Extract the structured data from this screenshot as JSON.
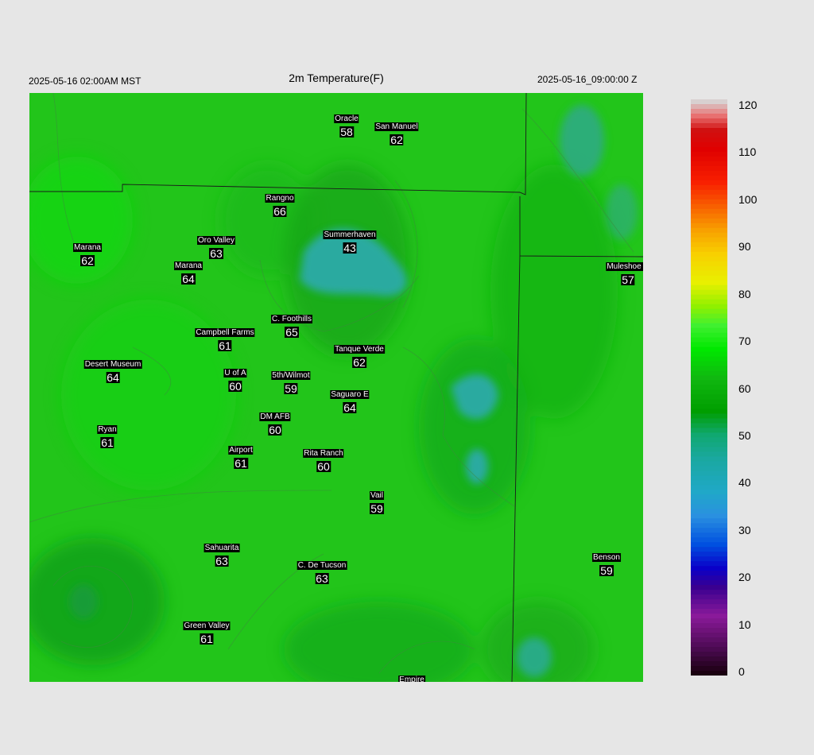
{
  "header": {
    "local_time": "2025-05-16 02:00AM MST",
    "title": "2m Temperature(F)",
    "utc_time": "2025-05-16_09:00:00 Z"
  },
  "map": {
    "base_color": "#22c51a",
    "cool_color": "#2aaaa0",
    "stations": [
      {
        "name": "Oracle",
        "value": "58"
      },
      {
        "name": "San Manuel",
        "value": "62"
      },
      {
        "name": "Rangno",
        "value": "66"
      },
      {
        "name": "Summerhaven",
        "value": "43"
      },
      {
        "name": "Marana",
        "value": "62"
      },
      {
        "name": "Oro Valley",
        "value": "63"
      },
      {
        "name": "Marana",
        "value": "64"
      },
      {
        "name": "Muleshoe R",
        "value": "57"
      },
      {
        "name": "C. Foothills",
        "value": "65"
      },
      {
        "name": "Campbell Farms",
        "value": "61"
      },
      {
        "name": "Tanque Verde",
        "value": "62"
      },
      {
        "name": "Desert Museum",
        "value": "64"
      },
      {
        "name": "U of A",
        "value": "60"
      },
      {
        "name": "5th/Wilmot",
        "value": "59"
      },
      {
        "name": "Saguaro E",
        "value": "64"
      },
      {
        "name": "DM AFB",
        "value": "60"
      },
      {
        "name": "Ryan",
        "value": "61"
      },
      {
        "name": "Airport",
        "value": "61"
      },
      {
        "name": "Rita Ranch",
        "value": "60"
      },
      {
        "name": "Vail",
        "value": "59"
      },
      {
        "name": "Sahuarita",
        "value": "63"
      },
      {
        "name": "C. De Tucson",
        "value": "63"
      },
      {
        "name": "Benson",
        "value": "59"
      },
      {
        "name": "Green Valley",
        "value": "61"
      },
      {
        "name": "Empire",
        "value": ""
      }
    ]
  },
  "colorbar": {
    "ticks": [
      "120",
      "110",
      "100",
      "90",
      "80",
      "70",
      "60",
      "50",
      "40",
      "30",
      "20",
      "10",
      "0"
    ]
  }
}
